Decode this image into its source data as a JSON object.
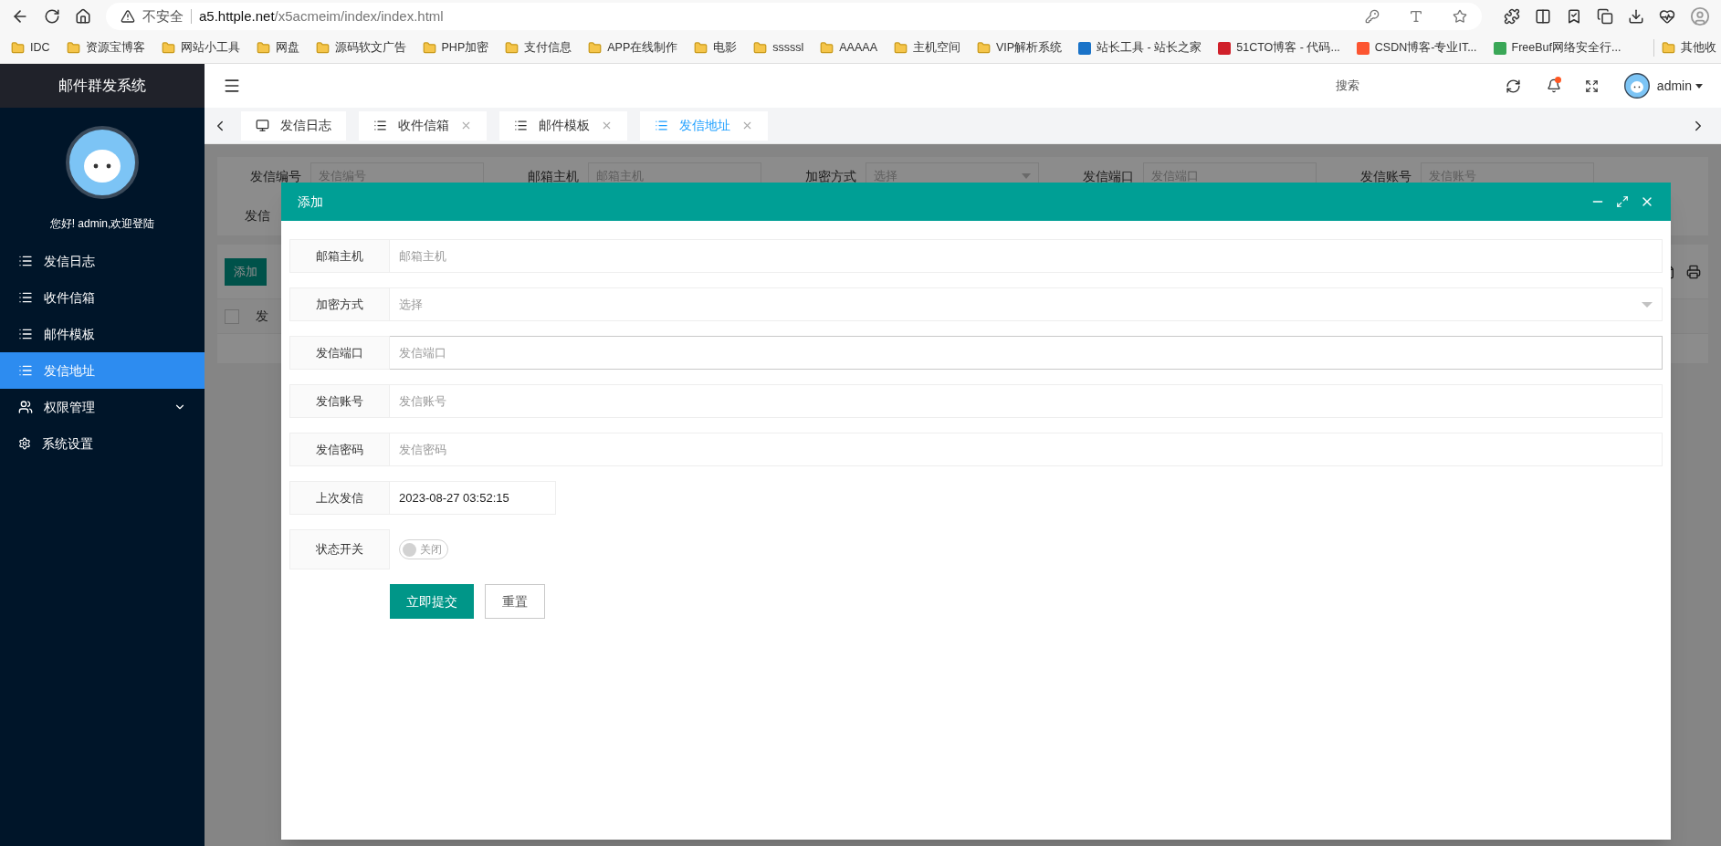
{
  "browser": {
    "security_label": "不安全",
    "url_host": "a5.httple.net",
    "url_path": "/x5acmeim/index/index.html",
    "bookmarks": [
      {
        "label": "IDC",
        "kind": "folder"
      },
      {
        "label": "资源宝博客",
        "kind": "folder"
      },
      {
        "label": "网站小工具",
        "kind": "folder"
      },
      {
        "label": "网盘",
        "kind": "folder"
      },
      {
        "label": "源码软文广告",
        "kind": "folder"
      },
      {
        "label": "PHP加密",
        "kind": "folder"
      },
      {
        "label": "支付信息",
        "kind": "folder"
      },
      {
        "label": "APP在线制作",
        "kind": "folder"
      },
      {
        "label": "电影",
        "kind": "folder"
      },
      {
        "label": "sssssl",
        "kind": "folder"
      },
      {
        "label": "AAAAA",
        "kind": "folder"
      },
      {
        "label": "主机空间",
        "kind": "folder"
      },
      {
        "label": "VIP解析系统",
        "kind": "folder"
      },
      {
        "label": "站长工具 - 站长之家",
        "kind": "site",
        "color": "#1a73c8"
      },
      {
        "label": "51CTO博客 - 代码...",
        "kind": "site",
        "color": "#d0202a"
      },
      {
        "label": "CSDN博客-专业IT...",
        "kind": "site",
        "color": "#fc5531"
      },
      {
        "label": "FreeBuf网络安全行...",
        "kind": "site",
        "color": "#3aa757"
      }
    ],
    "other_bookmarks": "其他收"
  },
  "sidebar": {
    "title": "邮件群发系统",
    "greeting": "您好! admin,欢迎登陆",
    "items": [
      {
        "label": "发信日志",
        "kind": "list",
        "selected": false
      },
      {
        "label": "收件信箱",
        "kind": "list",
        "selected": false
      },
      {
        "label": "邮件模板",
        "kind": "list",
        "selected": false
      },
      {
        "label": "发信地址",
        "kind": "list",
        "selected": true
      },
      {
        "label": "权限管理",
        "kind": "group",
        "selected": false,
        "expanded": false
      },
      {
        "label": "系统设置",
        "kind": "settings",
        "selected": false
      }
    ]
  },
  "header": {
    "search": "搜索",
    "user": "admin",
    "notification": true
  },
  "tabs": [
    {
      "label": "发信日志",
      "kind": "home",
      "selected": false
    },
    {
      "label": "收件信箱",
      "kind": "list",
      "selected": false
    },
    {
      "label": "邮件模板",
      "kind": "list",
      "selected": false
    },
    {
      "label": "发信地址",
      "kind": "list",
      "selected": true
    }
  ],
  "filters": [
    {
      "label": "发信编号",
      "placeholder": "发信编号",
      "kind": "input"
    },
    {
      "label": "邮箱主机",
      "placeholder": "邮箱主机",
      "kind": "input"
    },
    {
      "label": "加密方式",
      "placeholder": "选择",
      "kind": "select"
    },
    {
      "label": "发信端口",
      "placeholder": "发信端口",
      "kind": "input"
    },
    {
      "label": "发信账号",
      "placeholder": "发信账号",
      "kind": "input"
    }
  ],
  "filters_row2_label": "发信",
  "toolbar": {
    "add_button": "添加"
  },
  "table": {
    "column_1": "发",
    "select_all_checked": false
  },
  "dialog": {
    "title": "添加",
    "fields": [
      {
        "label": "邮箱主机",
        "kind": "input",
        "placeholder": "邮箱主机",
        "focused": false
      },
      {
        "label": "加密方式",
        "kind": "select",
        "placeholder": "选择",
        "focused": false
      },
      {
        "label": "发信端口",
        "kind": "input",
        "placeholder": "发信端口",
        "focused": true
      },
      {
        "label": "发信账号",
        "kind": "input",
        "placeholder": "发信账号",
        "focused": false
      },
      {
        "label": "发信密码",
        "kind": "input",
        "placeholder": "发信密码",
        "focused": false
      },
      {
        "label": "上次发信",
        "kind": "datetime",
        "value": "2023-08-27 03:52:15",
        "focused": false
      },
      {
        "label": "状态开关",
        "kind": "switch",
        "on": false,
        "off_text": "关闭"
      }
    ],
    "buttons": [
      {
        "label": "立即提交",
        "kind": "primary"
      },
      {
        "label": "重置",
        "kind": "secondary"
      }
    ]
  }
}
